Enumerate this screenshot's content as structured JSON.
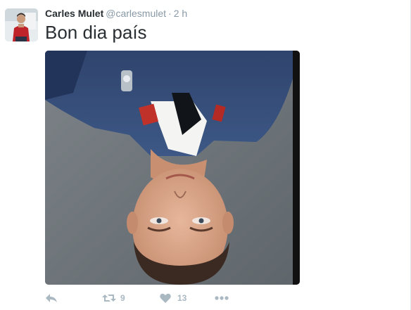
{
  "tweet": {
    "display_name": "Carles Mulet",
    "handle": "@carlesmulet",
    "separator": "·",
    "time": "2 h",
    "text": "Bon dia país",
    "avatar_icon": "user-avatar",
    "media_description_icon": "photo",
    "actions": {
      "reply_icon": "reply-icon",
      "retweet_icon": "retweet-icon",
      "retweet_count": "9",
      "like_icon": "heart-icon",
      "like_count": "13",
      "more_icon": "more-icon"
    }
  },
  "colors": {
    "name": "#292f33",
    "meta": "#8899a6",
    "action": "#aab8c2",
    "divider": "#e1e8ed"
  }
}
